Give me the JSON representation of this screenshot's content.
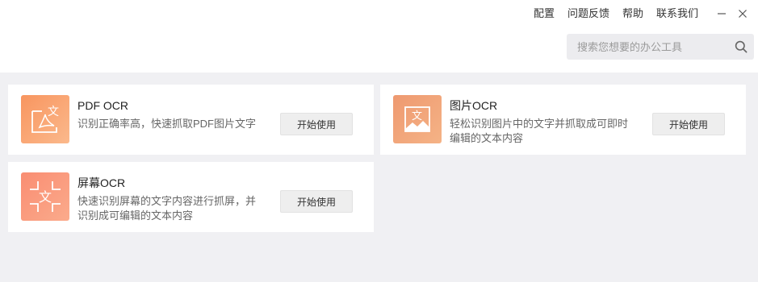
{
  "header": {
    "menu": [
      "配置",
      "问题反馈",
      "帮助",
      "联系我们"
    ],
    "search_placeholder": "搜索您想要的办公工具"
  },
  "tools": [
    {
      "title": "PDF OCR",
      "desc": "识别正确率高，快速抓取PDF图片文字",
      "button": "开始使用",
      "icon": "pdf-ocr-icon",
      "color": "#f9a67a"
    },
    {
      "title": "图片OCR",
      "desc": "轻松识别图片中的文字并抓取成可即时编辑的文本内容",
      "button": "开始使用",
      "icon": "image-ocr-icon",
      "color": "#f2a37a"
    },
    {
      "title": "屏幕OCR",
      "desc": "快速识别屏幕的文字内容进行抓屏，并识别成可编辑的文本内容",
      "button": "开始使用",
      "icon": "screen-ocr-icon",
      "color": "#fa9a7e"
    }
  ],
  "colors": {
    "background": "#f0f0f3",
    "card": "#ffffff",
    "button": "#eeeeee"
  }
}
